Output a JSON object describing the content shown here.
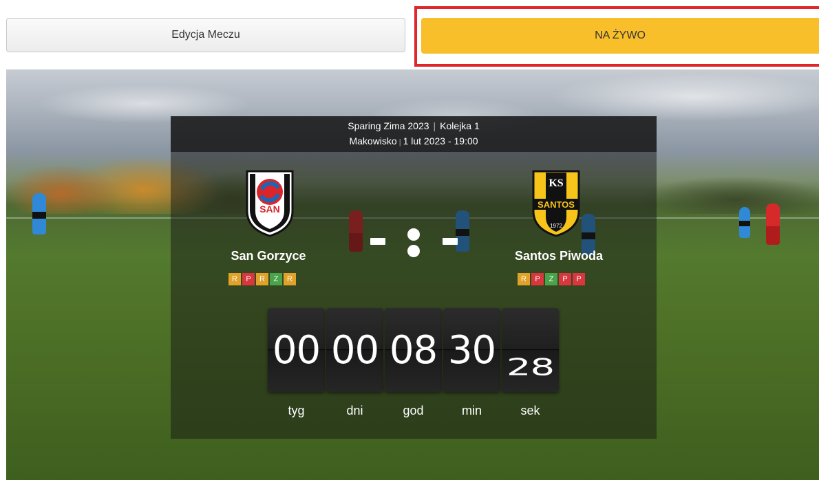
{
  "tabs": {
    "edit_label": "Edycja Meczu",
    "live_label": "NA ŻYWO"
  },
  "match": {
    "competition": "Sparing Zima 2023",
    "round": "Kolejka 1",
    "venue": "Makowisko",
    "datetime": "1 lut 2023 - 19:00",
    "home": {
      "name": "San Gorzyce",
      "crest_text": "SAN",
      "form": [
        "R",
        "P",
        "R",
        "Z",
        "R"
      ]
    },
    "away": {
      "name": "Santos Piwoda",
      "crest_text": "SANTOS",
      "crest_top": "KS",
      "crest_year": "1972",
      "form": [
        "R",
        "P",
        "Z",
        "P",
        "P"
      ]
    }
  },
  "countdown": {
    "values": [
      "00",
      "00",
      "08",
      "30",
      "28"
    ],
    "units": [
      "tyg",
      "dni",
      "god",
      "min",
      "sek"
    ]
  },
  "colors": {
    "live_tab": "#f8bf2b",
    "highlight_frame": "#e0262b",
    "form_r": "#e0a229",
    "form_p": "#d9363e",
    "form_z": "#4aa24a"
  }
}
